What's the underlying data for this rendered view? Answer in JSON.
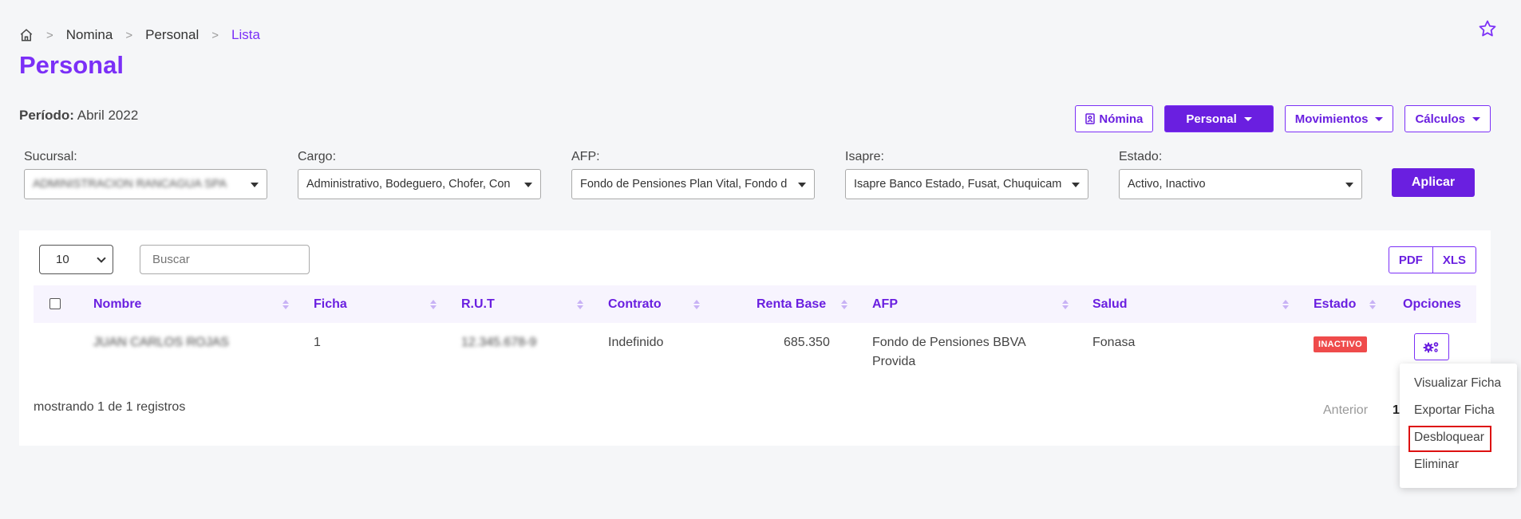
{
  "breadcrumb": {
    "items": [
      "Nomina",
      "Personal",
      "Lista"
    ]
  },
  "page_title": "Personal",
  "periodo": {
    "label": "Período:",
    "value": "Abril 2022"
  },
  "toolbar": {
    "nomina": "Nómina",
    "personal": "Personal",
    "movimientos": "Movimientos",
    "calculos": "Cálculos"
  },
  "filters": {
    "sucursal": {
      "label": "Sucursal:",
      "value": "ADMINISTRACION RANCAGUA SPA"
    },
    "cargo": {
      "label": "Cargo:",
      "value": "Administrativo, Bodeguero, Chofer, Con"
    },
    "afp": {
      "label": "AFP:",
      "value": "Fondo de Pensiones Plan Vital, Fondo d"
    },
    "isapre": {
      "label": "Isapre:",
      "value": "Isapre Banco Estado, Fusat, Chuquicam"
    },
    "estado": {
      "label": "Estado:",
      "value": "Activo, Inactivo"
    },
    "apply_label": "Aplicar"
  },
  "table_controls": {
    "per_page": "10",
    "search_placeholder": "Buscar",
    "pdf": "PDF",
    "xls": "XLS"
  },
  "table": {
    "columns": [
      "Nombre",
      "Ficha",
      "R.U.T",
      "Contrato",
      "Renta Base",
      "AFP",
      "Salud",
      "Estado",
      "Opciones"
    ],
    "rows": [
      {
        "nombre": "JUAN CARLOS ROJAS",
        "ficha": "1",
        "rut": "12.345.678-9",
        "contrato": "Indefinido",
        "renta_base": "685.350",
        "afp_line1": "Fondo de Pensiones BBVA",
        "afp_line2": "Provida",
        "salud": "Fonasa",
        "estado": "INACTIVO"
      }
    ]
  },
  "footer": {
    "mostrando": "mostrando 1 de 1 registros",
    "anterior": "Anterior",
    "page": "1"
  },
  "options_menu": {
    "items": [
      "Visualizar Ficha",
      "Exportar Ficha",
      "Desbloquear",
      "Eliminar"
    ]
  },
  "colors": {
    "accent": "#7b2ff7",
    "primary_button": "#6a1fe0",
    "danger": "#ef4b4b",
    "highlight": "#dd1111"
  }
}
